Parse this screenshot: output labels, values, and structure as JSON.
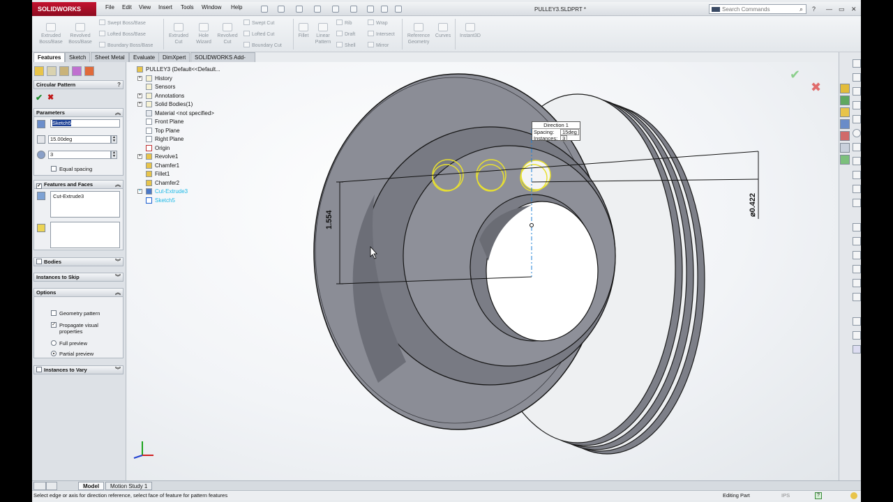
{
  "app": {
    "logo_text": "SOLIDWORKS",
    "doc_title": "PULLEY3.SLDPRT *"
  },
  "menu": [
    "File",
    "Edit",
    "View",
    "Insert",
    "Tools",
    "Window",
    "Help"
  ],
  "search": {
    "placeholder": "Search Commands"
  },
  "window_buttons": [
    "?",
    "—",
    "▭",
    "✕"
  ],
  "commands": {
    "extruded_boss": "Extruded Boss/Base",
    "revolved_boss": "Revolved Boss/Base",
    "swept_boss": "Swept Boss/Base",
    "lofted_boss": "Lofted Boss/Base",
    "boundary_boss": "Boundary Boss/Base",
    "extruded_cut": "Extruded Cut",
    "hole_wizard": "Hole Wizard",
    "revolved_cut": "Revolved Cut",
    "swept_cut": "Swept Cut",
    "lofted_cut": "Lofted Cut",
    "boundary_cut": "Boundary Cut",
    "fillet": "Fillet",
    "linear_pattern": "Linear Pattern",
    "rib": "Rib",
    "draft": "Draft",
    "shell": "Shell",
    "wrap": "Wrap",
    "intersect": "Intersect",
    "mirror": "Mirror",
    "reference_geometry": "Reference Geometry",
    "curves": "Curves",
    "instant3d": "Instant3D"
  },
  "tabs": [
    "Features",
    "Sketch",
    "Sheet Metal",
    "Evaluate",
    "DimXpert",
    "SOLIDWORKS Add-Ins"
  ],
  "pm": {
    "title": "Circular Pattern",
    "ok": "✔",
    "cancel": "✖",
    "parameters": {
      "header": "Parameters",
      "direction_ref": "Sketch5",
      "angle": "15.00deg",
      "instances": "3",
      "equal_spacing_label": "Equal spacing",
      "equal_spacing_checked": false
    },
    "features_and_faces": {
      "header": "Features and Faces",
      "features": [
        "Cut-Extrude3"
      ],
      "faces": []
    },
    "bodies": {
      "header": "Bodies"
    },
    "instances_to_skip": {
      "header": "Instances to Skip"
    },
    "options": {
      "header": "Options",
      "geometry_pattern_label": "Geometry pattern",
      "geometry_pattern_checked": false,
      "propagate_label_1": "Propagate visual",
      "propagate_label_2": "properties",
      "propagate_checked": true,
      "full_preview_label": "Full preview",
      "partial_preview_label": "Partial preview",
      "preview_mode": "partial"
    },
    "instances_to_vary": {
      "header": "Instances to Vary"
    }
  },
  "tree": {
    "root": "PULLEY3  (Default<<Default...",
    "items": [
      {
        "label": "History",
        "icon": "history-icon",
        "expandable": true
      },
      {
        "label": "Sensors",
        "icon": "sensors-icon",
        "expandable": false
      },
      {
        "label": "Annotations",
        "icon": "annotations-icon",
        "expandable": true
      },
      {
        "label": "Solid Bodies(1)",
        "icon": "solid-bodies-icon",
        "expandable": true
      },
      {
        "label": "Material <not specified>",
        "icon": "material-icon",
        "expandable": false
      },
      {
        "label": "Front Plane",
        "icon": "plane-icon",
        "expandable": false
      },
      {
        "label": "Top Plane",
        "icon": "plane-icon",
        "expandable": false
      },
      {
        "label": "Right Plane",
        "icon": "plane-icon",
        "expandable": false
      },
      {
        "label": "Origin",
        "icon": "origin-icon",
        "expandable": false
      },
      {
        "label": "Revolve1",
        "icon": "revolve-icon",
        "expandable": true
      },
      {
        "label": "Chamfer1",
        "icon": "chamfer-icon",
        "expandable": false
      },
      {
        "label": "Fillet1",
        "icon": "fillet-icon",
        "expandable": false
      },
      {
        "label": "Chamfer2",
        "icon": "chamfer-icon",
        "expandable": false
      },
      {
        "label": "Cut-Extrude3",
        "icon": "cut-extrude-icon",
        "expandable": true,
        "highlight": true
      },
      {
        "label": "Sketch5",
        "icon": "sketch-icon",
        "expandable": false,
        "highlight": true
      }
    ]
  },
  "callout": {
    "title": "Direction 1",
    "spacing_label": "Spacing:",
    "spacing_value": "15deg",
    "instances_label": "Instances:",
    "instances_value": "3"
  },
  "dimensions": {
    "vertical": "1.554",
    "diameter": "⌀0.422"
  },
  "bottom_tabs": [
    "Model",
    "Motion Study 1"
  ],
  "status": {
    "message": "Select edge or axis for direction reference, select face of feature for pattern features",
    "mode": "Editing Part",
    "units": "IPS"
  },
  "colors": {
    "accent_red": "#c4122f",
    "selection_yellow": "#e8e030",
    "part_gray": "#8a8c95",
    "highlight_cyan": "#1bb8e6"
  }
}
